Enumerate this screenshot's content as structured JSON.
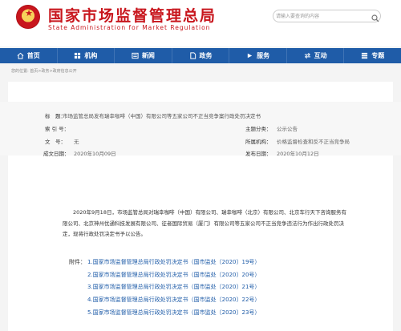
{
  "header": {
    "title_cn": "国家市场监督管理总局",
    "title_en": "State Administration for Market Regulation",
    "search_placeholder": "请输入要查询的内容"
  },
  "nav": [
    {
      "label": "首页",
      "icon": "home-icon"
    },
    {
      "label": "机构",
      "icon": "building-icon"
    },
    {
      "label": "新闻",
      "icon": "news-icon"
    },
    {
      "label": "政务",
      "icon": "document-icon"
    },
    {
      "label": "服务",
      "icon": "service-icon"
    },
    {
      "label": "互动",
      "icon": "interaction-icon"
    },
    {
      "label": "专题",
      "icon": "topic-icon"
    }
  ],
  "breadcrumb": "您的位置: 首页>政务>政府信息公开",
  "meta": {
    "title_label": "标　题：",
    "title_value": "市场监管总局发布瑞幸咖啡（中国）有限公司等五家公司不正当竞争案行政处罚决定书",
    "index_label": "索 引 号：",
    "index_value": "",
    "category_label": "主题分类：",
    "category_value": "公示公告",
    "doc_no_label": "文　号：",
    "doc_no_value": "无",
    "dept_label": "所属机构：",
    "dept_value": "价格监督检查和反不正当竞争局",
    "created_label": "成文日期：",
    "created_value": "2020年10月09日",
    "published_label": "发布日期：",
    "published_value": "2020年10月12日"
  },
  "body": "2020年9月18日，市场监管总局对瑞幸咖啡（中国）有限公司、瑞幸咖啡（北京）有限公司、北京车行天下咨询服务有限公司、北京神州优通科技发展有限公司、征者国际贸易（厦门）有限公司等五家公司不正当竞争违法行为作出行政处罚决定，现将行政处罚决定书予以公告。",
  "attachments_label": "附件：",
  "attachments": [
    "1.国家市场监督管理总局行政处罚决定书（国市监处〔2020〕19号）",
    "2.国家市场监督管理总局行政处罚决定书（国市监处〔2020〕20号）",
    "3.国家市场监督管理总局行政处罚决定书（国市监处〔2020〕21号）",
    "4.国家市场监督管理总局行政处罚决定书（国市监处〔2020〕22号）",
    "5.国家市场监督管理总局行政处罚决定书（国市监处〔2020〕23号）"
  ],
  "colors": {
    "brand_red": "#c8161d",
    "nav_blue": "#1f5ca8"
  }
}
